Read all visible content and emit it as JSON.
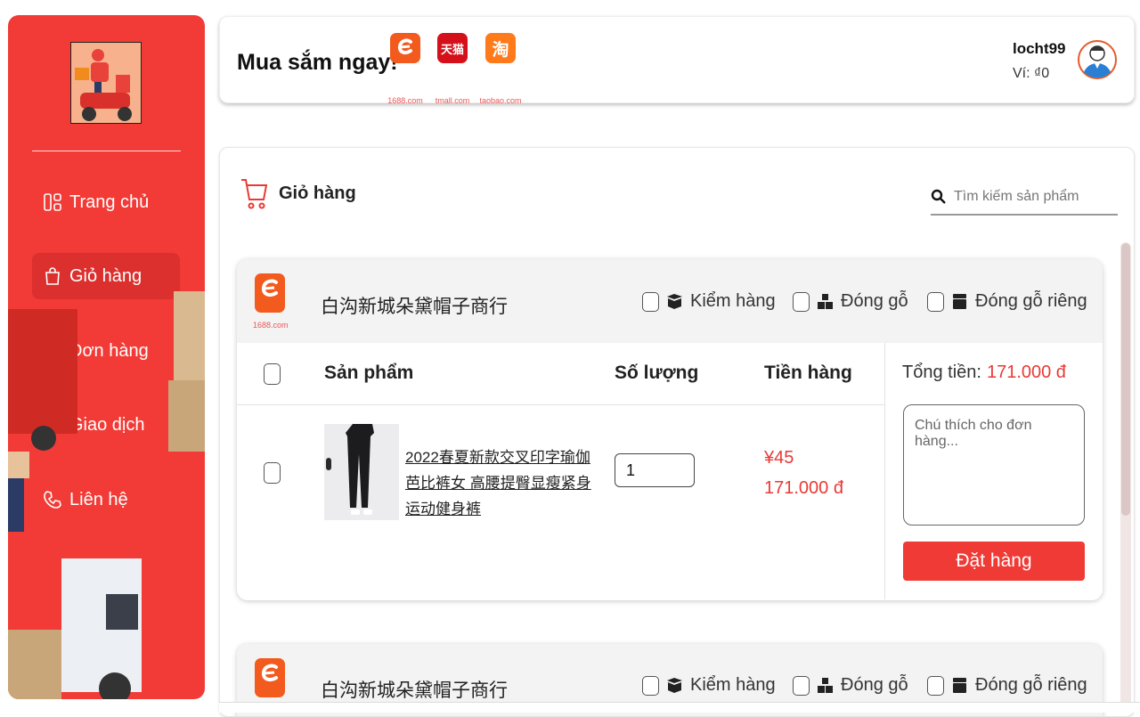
{
  "sidebar": {
    "items": [
      {
        "label": "Trang chủ",
        "icon": "grid-icon"
      },
      {
        "label": "Giỏ hàng",
        "icon": "shopping-bag-icon"
      },
      {
        "label": "Đơn hàng",
        "icon": "list-icon"
      },
      {
        "label": "Giao dịch",
        "icon": "exchange-icon"
      },
      {
        "label": "Liên hệ",
        "icon": "phone-icon"
      }
    ],
    "active_index": 1
  },
  "header": {
    "title": "Mua sắm ngay!",
    "shops": [
      {
        "label": "1688.com",
        "mark": "e",
        "color": "#f25a1e"
      },
      {
        "label": "tmall.com",
        "mark": "天猫",
        "color": "#d4111b"
      },
      {
        "label": "taobao.com",
        "mark": "淘",
        "color": "#ff7a1a"
      }
    ],
    "user_name": "locht99",
    "wallet": "Ví: ₫0"
  },
  "cart": {
    "title": "Giỏ hàng",
    "search_placeholder": "Tìm kiếm sản phẩm",
    "options": [
      "Kiểm hàng",
      "Đóng gỗ",
      "Đóng gỗ riêng"
    ],
    "columns": [
      "Sản phẩm",
      "Số lượng",
      "Tiền hàng"
    ],
    "shops": [
      {
        "logo_caption": "1688.com",
        "name": "白沟新城朵黛帽子商行",
        "items": [
          {
            "name": "2022春夏新款交叉印字瑜伽芭比裤女 高腰提臀显瘦紧身运动健身裤",
            "quantity": "1",
            "price_cny": "¥45",
            "price_vnd": "171.000 đ"
          }
        ],
        "total_label": "Tổng tiền:",
        "total_value": "171.000 đ",
        "note_placeholder": "Chú thích cho đơn hàng...",
        "order_button": "Đặt hàng"
      },
      {
        "name": "白沟新城朵黛帽子商行"
      }
    ]
  },
  "colors": {
    "brand": "#f23b36",
    "accent": "#e83a35"
  }
}
